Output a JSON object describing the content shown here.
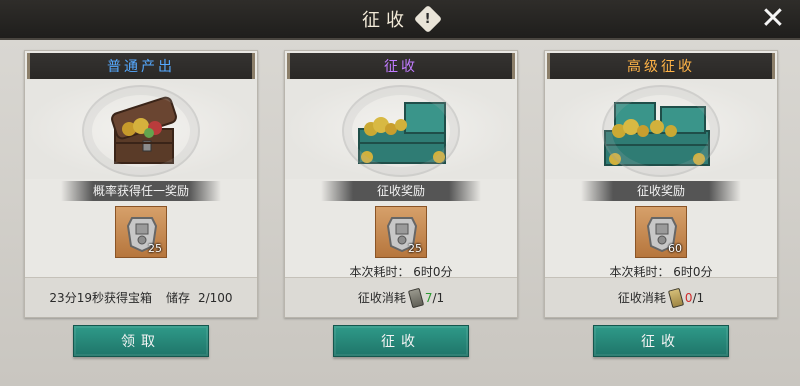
{
  "window": {
    "title": "征收",
    "info_icon": "!",
    "close_icon": "✕"
  },
  "cards": [
    {
      "header": "普通产出",
      "header_color": "#55a9ff",
      "reward_label": "概率获得任一奖励",
      "item_count": "25",
      "footer_left": "23分19秒获得宝箱",
      "footer_store_label": "储存",
      "footer_store_value": "2/100",
      "button_label": "领取"
    },
    {
      "header": "征收",
      "header_color": "#c07bff",
      "reward_label": "征收奖励",
      "item_count": "25",
      "time_label": "本次耗时：",
      "time_value": "6时0分",
      "cost_label": "征收消耗",
      "cost_have": "7",
      "cost_need": "/1",
      "button_label": "征收"
    },
    {
      "header": "高级征收",
      "header_color": "#ffb347",
      "reward_label": "征收奖励",
      "item_count": "60",
      "time_label": "本次耗时：",
      "time_value": "6时0分",
      "cost_label": "征收消耗",
      "cost_have": "0",
      "cost_need": "/1",
      "button_label": "征收"
    }
  ]
}
